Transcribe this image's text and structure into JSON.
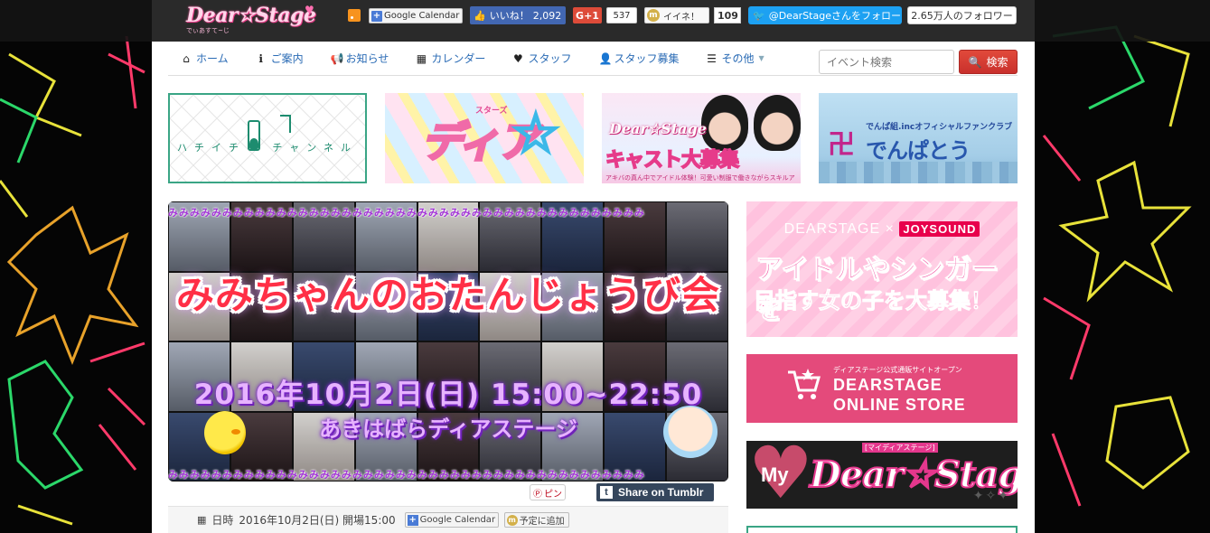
{
  "topbar": {
    "logo_text": "Dear☆Stage",
    "logo_sub": "でぃあすて~じ",
    "google_calendar_label": "Google Calendar",
    "facebook_label": "いいね！",
    "facebook_count": "2,092",
    "gplus_label": "G+1",
    "gplus_count": "537",
    "mixi_label": "イイネ！",
    "mixi_count": "109",
    "twitter_label": "@DearStageさんをフォロー",
    "twitter_count": "2.65万人のフォロワー"
  },
  "nav": {
    "items": [
      {
        "label": "ホーム",
        "icon": "home-icon",
        "glyph": "⌂"
      },
      {
        "label": "ご案内",
        "icon": "info-icon",
        "glyph": "ℹ"
      },
      {
        "label": "お知らせ",
        "icon": "megaphone-icon",
        "glyph": "📢"
      },
      {
        "label": "カレンダー",
        "icon": "calendar-icon",
        "glyph": "▦"
      },
      {
        "label": "スタッフ",
        "icon": "heart-icon",
        "glyph": "♥"
      },
      {
        "label": "スタッフ募集",
        "icon": "user-icon",
        "glyph": "👤"
      },
      {
        "label": "その他",
        "icon": "list-icon",
        "glyph": "☰"
      }
    ],
    "search_placeholder": "イベント検索",
    "search_button": "検索"
  },
  "banners": {
    "hachichi": {
      "text": "ハチイチ",
      "text2": "チャンネル"
    },
    "dears": {
      "main": "ディア",
      "ruby": "スターズ"
    },
    "cast": {
      "logo": "Dear☆Stage",
      "headline": "キャスト大募集",
      "small": "アキバの真ん中でアイドル体験！可愛い制服で働きながらスキルアップ！"
    },
    "denpatoh": {
      "caption": "でんぱ組.incオフィシャルファンクラブ",
      "name": "でんぱとう"
    }
  },
  "hero": {
    "strip": "みみみみみみみみみみみみみみみみみみみみみみみみみみみみみみみみみみみみみみみみみみみみ",
    "title": "みみちゃんのおたんじょうび会",
    "date": "2016年10月2日(日) 15:00~22:50",
    "venue": "あきはばらディアステージ"
  },
  "share": {
    "pin_label": "ピン",
    "tumblr_label": "Share on Tumblr"
  },
  "event_info": {
    "label": "日時",
    "value": "2016年10月2日(日) 開場15:00",
    "gcal_label": "Google Calendar",
    "yotei_label": "予定に追加"
  },
  "side": {
    "joysound": {
      "brand": "DEARSTAGE",
      "cross": "×",
      "partner": "JOYSOUND",
      "line1": "アイドルやシンガーを",
      "line2": "目指す女の子を大募集！"
    },
    "store": {
      "caption": "ディアステージ公式通販サイトオープン",
      "line1": "DEARSTAGE",
      "line2": "ONLINE STORE"
    },
    "mydear": {
      "my": "My",
      "dear": "Dear☆Stage",
      "sub": "[マイディアステージ]"
    }
  }
}
